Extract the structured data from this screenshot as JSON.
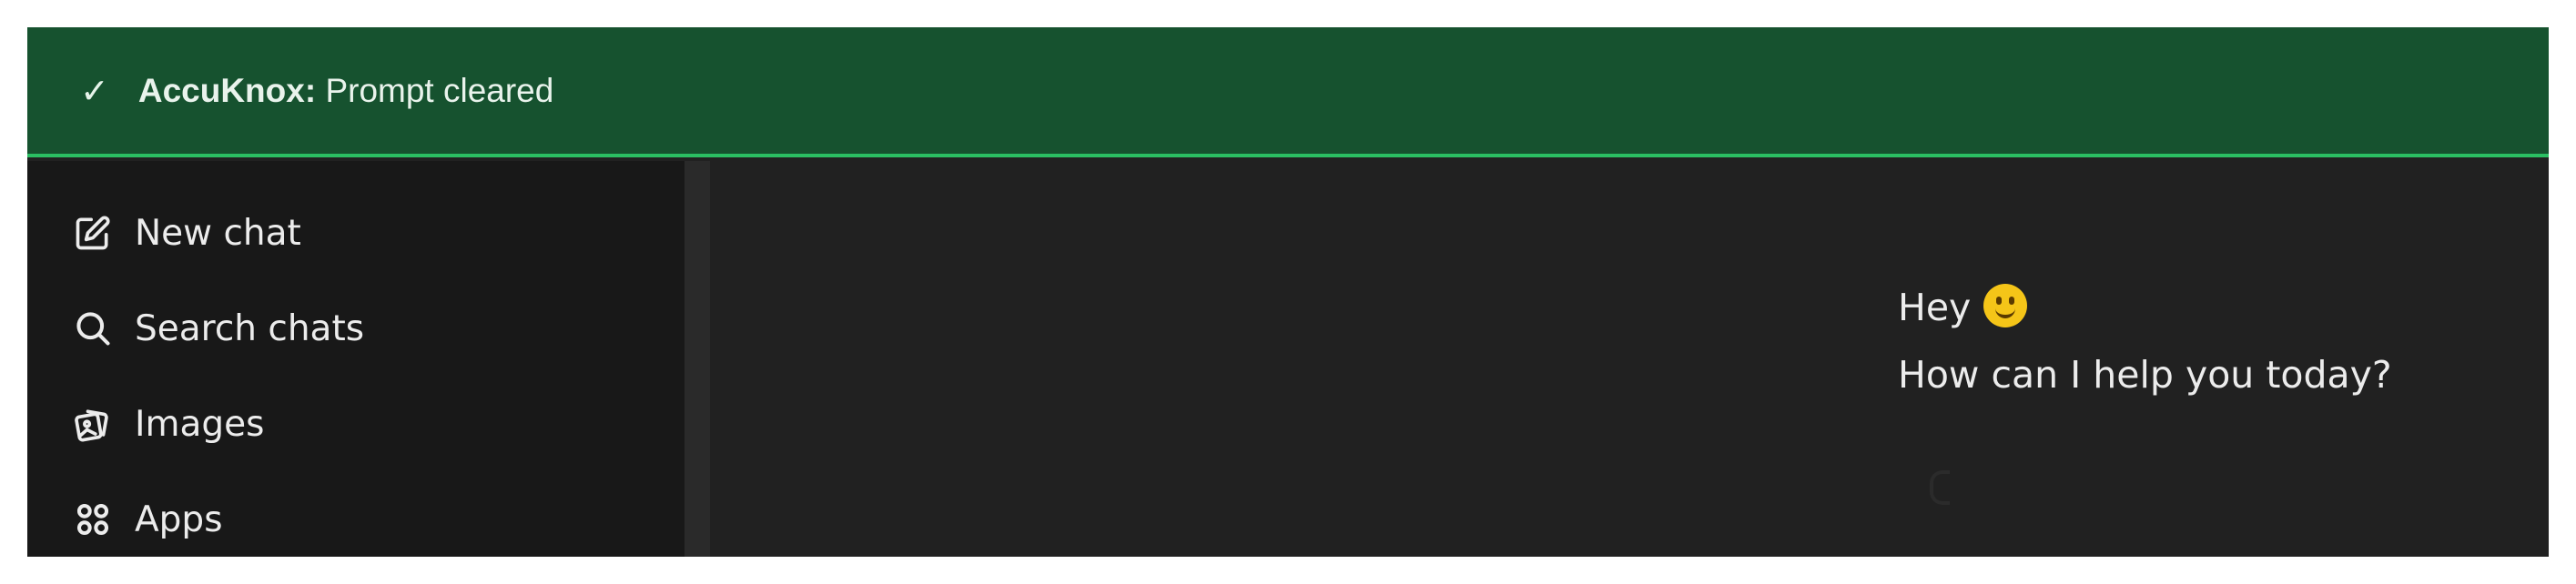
{
  "toast": {
    "check": "✓",
    "brand": "AccuKnox:",
    "message": "Prompt cleared",
    "colors": {
      "background": "#16522f",
      "accent_line": "#2bbf63"
    }
  },
  "sidebar": {
    "items": [
      {
        "label": "New chat",
        "icon": "edit-icon"
      },
      {
        "label": "Search chats",
        "icon": "search-icon"
      },
      {
        "label": "Images",
        "icon": "images-icon"
      },
      {
        "label": "Apps",
        "icon": "apps-icon"
      }
    ]
  },
  "main": {
    "greeting_line1": "Hey",
    "greeting_emoji": "smiley-emoji",
    "greeting_line2": "How can I help you today?"
  },
  "theme": {
    "sidebar_bg": "#181818",
    "main_bg": "#212121",
    "text": "#ececec"
  }
}
